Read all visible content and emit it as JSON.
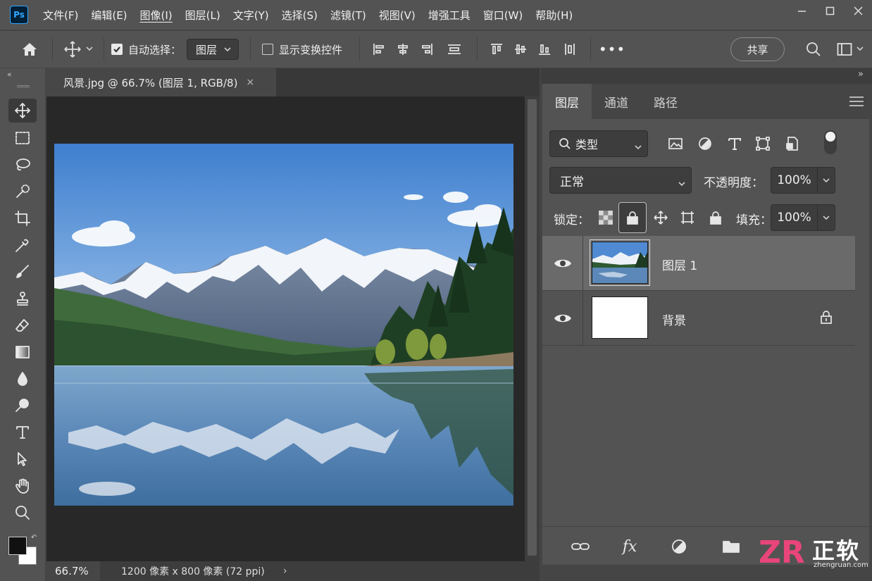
{
  "app": {
    "logo": "Ps"
  },
  "menu": [
    "文件(F)",
    "编辑(E)",
    "图像(I)",
    "图层(L)",
    "文字(Y)",
    "选择(S)",
    "滤镜(T)",
    "视图(V)",
    "增强工具",
    "窗口(W)",
    "帮助(H)"
  ],
  "options": {
    "auto_select_label": "自动选择：",
    "auto_select_value": "图层",
    "show_transform_label": "显示变换控件",
    "share_label": "共享"
  },
  "document": {
    "tab_title": "风景.jpg @ 66.7% (图层 1, RGB/8)",
    "close": "×",
    "zoom": "66.7%",
    "info": "1200 像素 x 800 像素 (72 ppi)"
  },
  "panel": {
    "tabs": [
      "图层",
      "通道",
      "路径"
    ],
    "filter_label": "类型",
    "blend_mode": "正常",
    "opacity_label": "不透明度：",
    "opacity_value": "100%",
    "lock_label": "锁定：",
    "fill_label": "填充：",
    "fill_value": "100%",
    "layers": [
      {
        "name": "图层 1",
        "selected": true,
        "visible": true
      },
      {
        "name": "背景",
        "selected": false,
        "visible": true,
        "locked": true
      }
    ],
    "footer_fx": "fx"
  },
  "watermark": {
    "text": "正软",
    "url": "zhengruan.com",
    "mark": "ZR"
  },
  "colors": {
    "accent": "#31a8ff",
    "panel_bg": "#535353",
    "canvas_bg": "#282828"
  }
}
